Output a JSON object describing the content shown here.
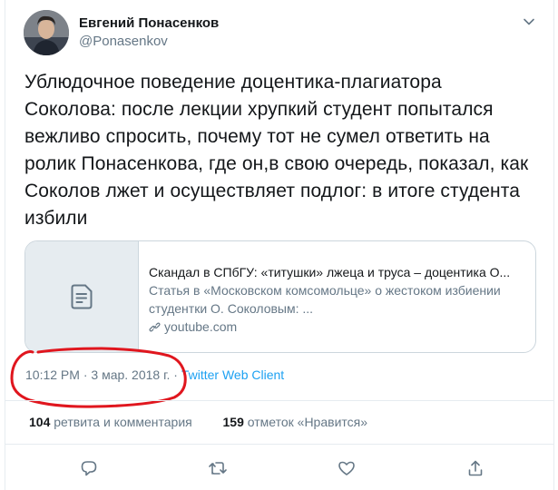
{
  "author": {
    "name": "Евгений Понасенков",
    "handle": "@Ponasenkov"
  },
  "tweet": {
    "text": "Ублюдочное поведение доцентика-плагиатора Соколова: после лекции хрупкий студент попытался вежливо спросить, почему тот не сумел ответить на ролик Понасенкова, где он,в свою очередь, показал, как Соколов лжет и осуществляет подлог: в итоге студента избили"
  },
  "card": {
    "title": "Скандал в СПбГУ: «титушки» лжеца и труса – доцентика О...",
    "description": "Статья в «Московском комсомольце» о жестоком избиении студентки О. Соколовым: ...",
    "domain": "youtube.com"
  },
  "meta": {
    "time": "10:12 PM",
    "separator": "·",
    "date": "3 мар. 2018 г.",
    "source": "Twitter Web Client"
  },
  "stats": {
    "retweets_count": "104",
    "retweets_label": "ретвита и комментария",
    "likes_count": "159",
    "likes_label": "отметок «Нравится»"
  },
  "colors": {
    "text": "#14171a",
    "secondary": "#657786",
    "link": "#1da1f2",
    "border": "#ccd6dd",
    "annotation": "#e0161e"
  },
  "icons": [
    "chevron-down-icon",
    "article-icon",
    "link-icon",
    "reply-icon",
    "retweet-icon",
    "like-icon",
    "share-icon"
  ]
}
